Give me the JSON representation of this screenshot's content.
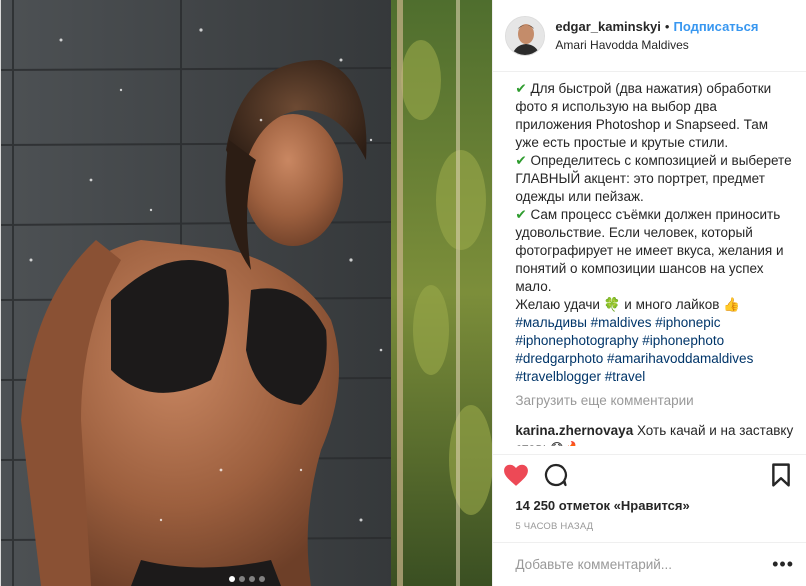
{
  "header": {
    "username": "edgar_kaminskyi",
    "separator": "•",
    "follow_label": "Подписаться",
    "location": "Amari Havodda Maldives"
  },
  "caption": {
    "lines": [
      {
        "icon": "check-icon",
        "text": " Для быстрой (два нажатия) обработки фото я использую на выбор два приложения Photoshop и Snapseed. Там уже есть простые и крутые стили."
      },
      {
        "icon": "check-icon",
        "text": " Определитесь с композицией и выберете ГЛАВНЫЙ акцент: это портрет, предмет одежды или пейзаж."
      },
      {
        "icon": "check-icon",
        "text": " Сам процесс съёмки должен приносить удовольствие. Если человек, который фотографирует не имеет вкуса, желания и понятий о композиции шансов на успех мало."
      }
    ],
    "wish_before": "Желаю удачи ",
    "clover": "🍀",
    "wish_after": " и много лайков ",
    "thumb": "👍",
    "hashtags": [
      "#мальдивы",
      "#maldives",
      "#iphonepic",
      "#iphonephotography",
      "#iphonephoto",
      "#dredgarphoto",
      "#amarihavoddamaldives",
      "#travelblogger",
      "#travel"
    ]
  },
  "load_more": "Загрузить еще комментарии",
  "comment": {
    "username": "karina.zhernovaya",
    "text": " Хоть качай и на заставку ставь",
    "emoji": "😱🔥"
  },
  "actions": {
    "like_icon": "heart-icon",
    "comment_icon": "comment-icon",
    "save_icon": "bookmark-icon",
    "like_color": "#ed4956"
  },
  "likes_text": "14 250 отметок «Нравится»",
  "time_text": "5 часов назад",
  "add_comment": {
    "placeholder": "Добавьте комментарий...",
    "more": "•••"
  },
  "carousel": {
    "count": 4,
    "active": 1
  }
}
